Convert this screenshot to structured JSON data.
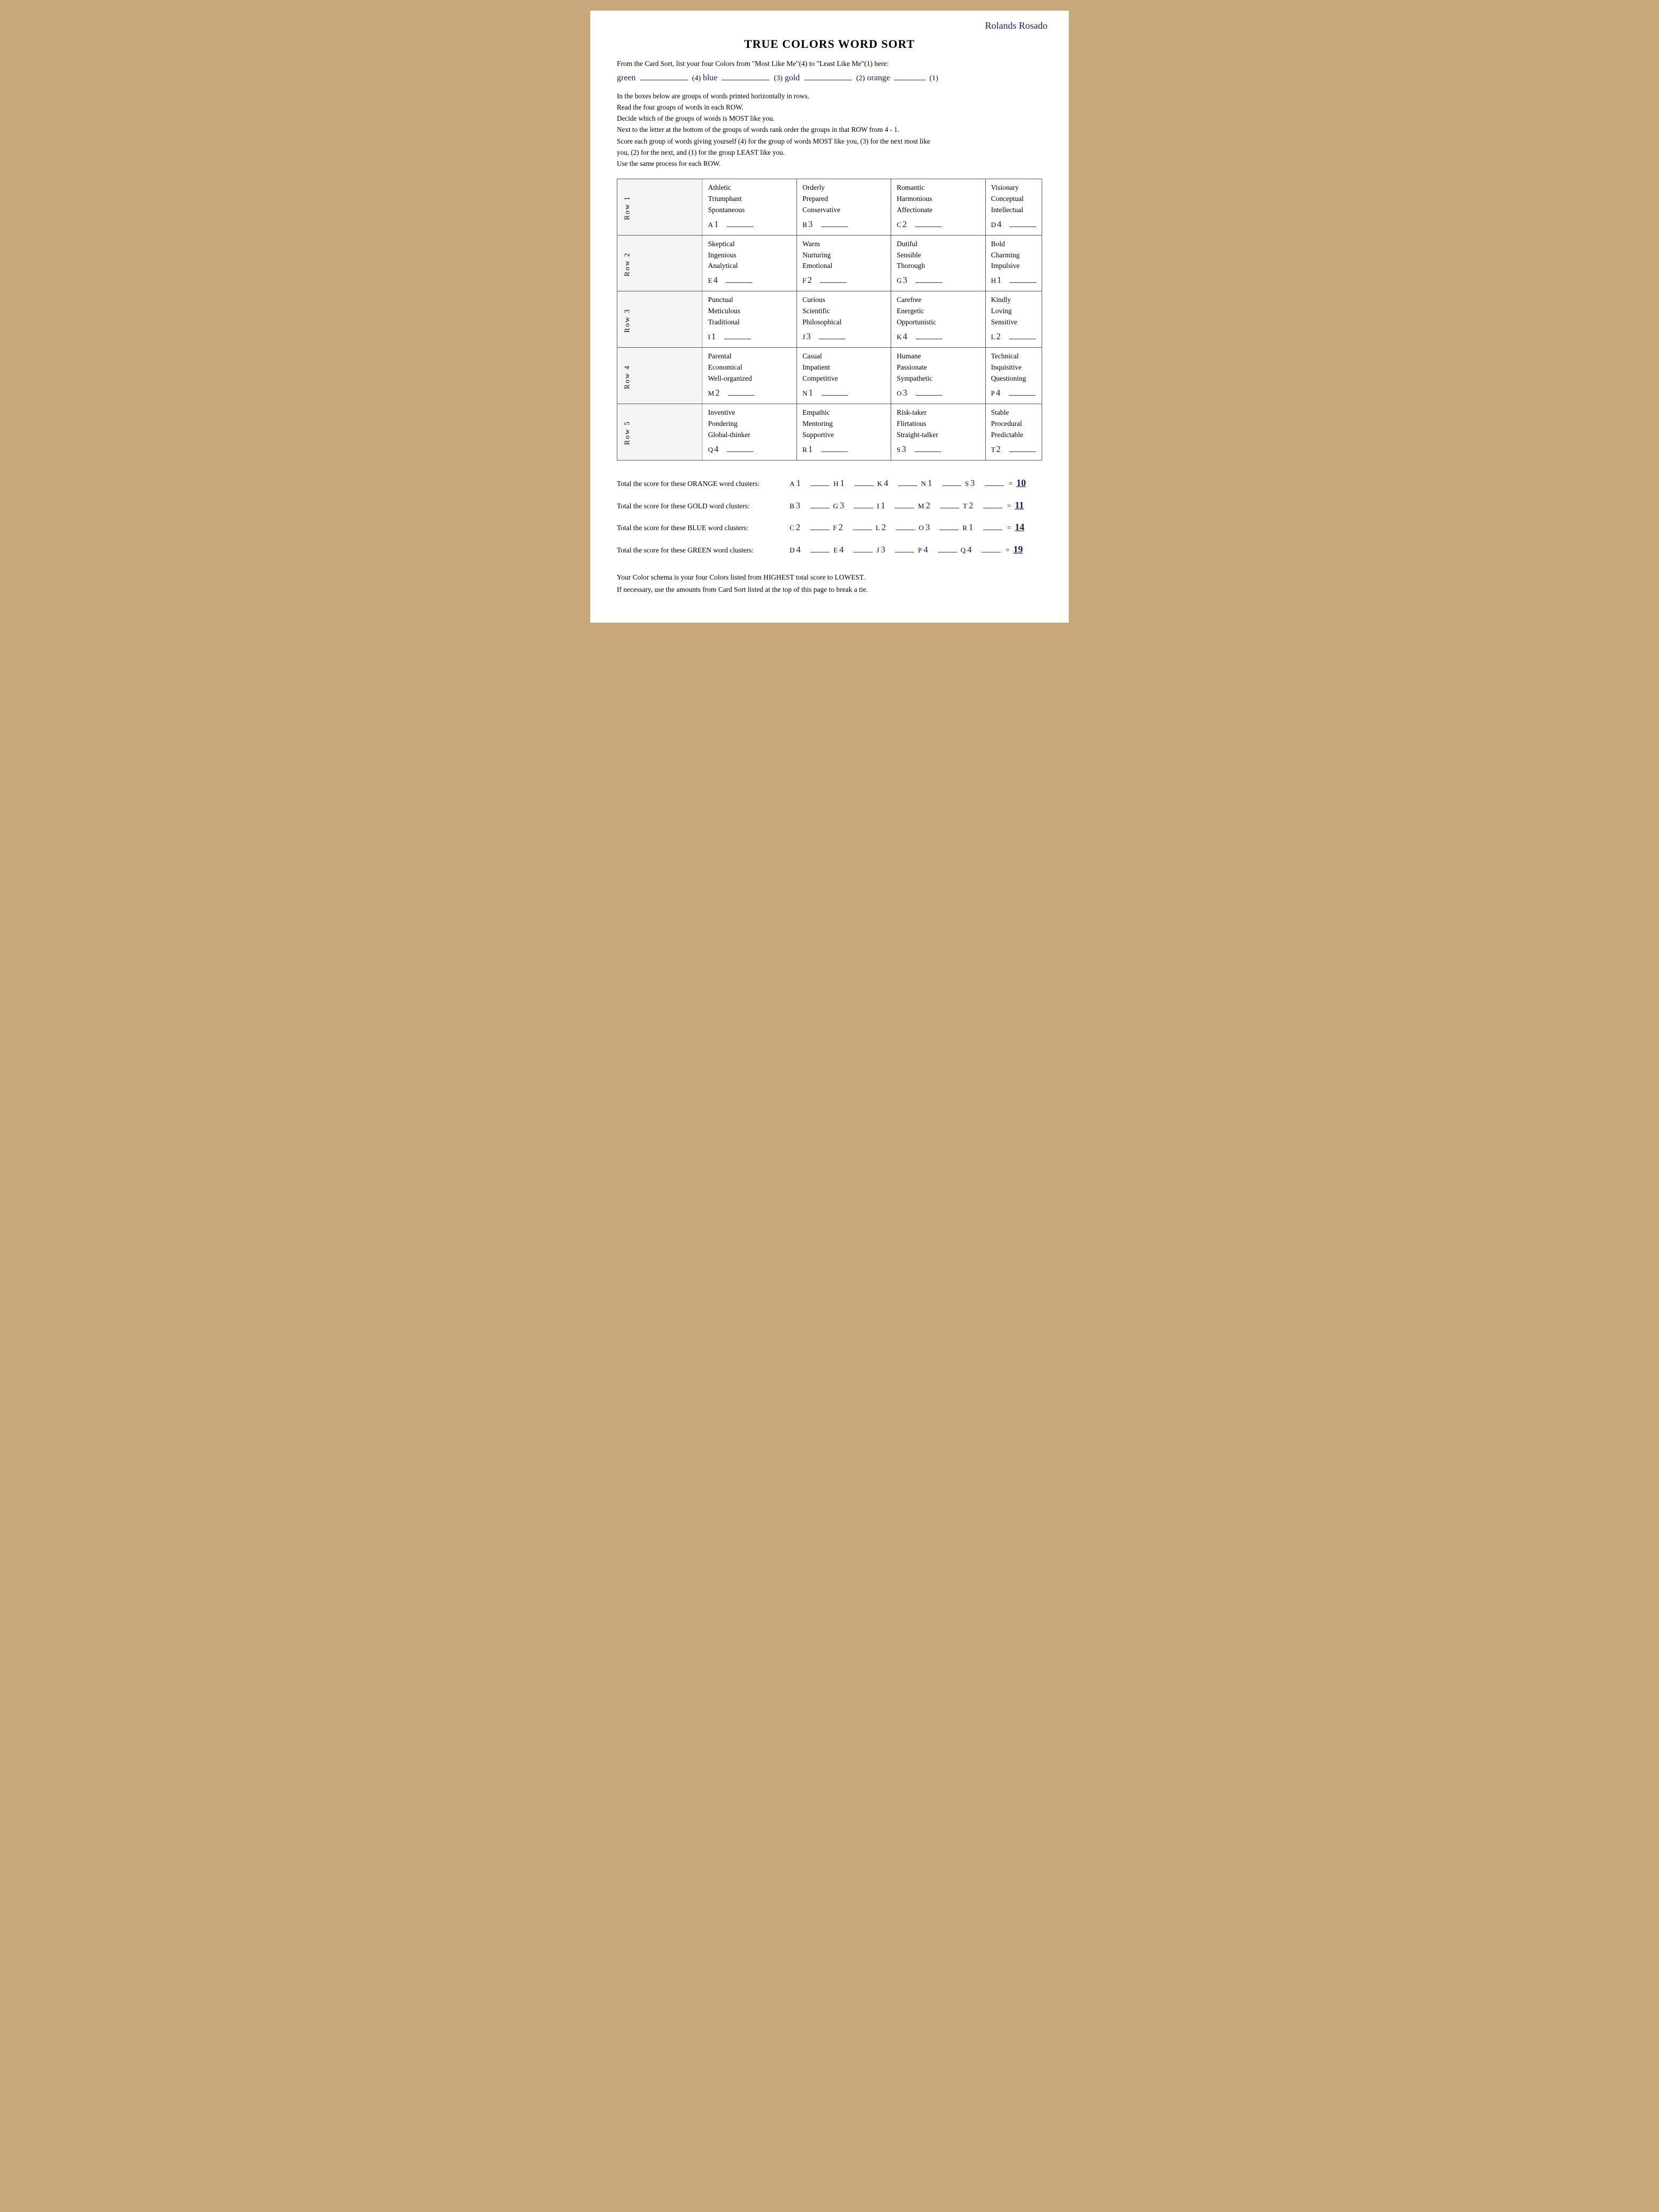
{
  "page": {
    "name": "Rolands Rosado",
    "title": "TRUE COLORS WORD SORT",
    "instruction_top": "From the Card Sort, list your four Colors from \"Most Like Me\"(4) to \"Least Like Me\"(1) here:",
    "color_order": {
      "color1": "green",
      "rank1": "(4)",
      "color2": "blue",
      "rank2": "(3)",
      "color3": "gold",
      "rank3": "(2)",
      "color4": "orange",
      "rank4": "(1)"
    },
    "instructions": [
      "In the boxes below are groups of words printed horizontally in rows.",
      "Read the four groups of words in each ROW.",
      "Decide which of the groups of words is MOST like you.",
      "Next to the letter at the bottom of the groups of words rank order the groups in that ROW from 4 - 1.",
      "Score each group of words giving yourself (4) for the group of words MOST like you, (3) for the next most like",
      "you, (2) for the next, and (1) for the group LEAST like you.",
      "Use the same process for each ROW."
    ],
    "rows": [
      {
        "label": "Row 1",
        "cells": [
          {
            "words": [
              "Athletic",
              "Triumphant",
              "Spontaneous"
            ],
            "letter": "A",
            "score": "1"
          },
          {
            "words": [
              "Orderly",
              "Prepared",
              "Conservative"
            ],
            "letter": "B",
            "score": "3"
          },
          {
            "words": [
              "Romantic",
              "Harmonious",
              "Affectionate"
            ],
            "letter": "C",
            "score": "2"
          },
          {
            "words": [
              "Visionary",
              "Conceptual",
              "Intellectual"
            ],
            "letter": "D",
            "score": "4"
          }
        ]
      },
      {
        "label": "Row 2",
        "cells": [
          {
            "words": [
              "Skeptical",
              "Ingenious",
              "Analytical"
            ],
            "letter": "E",
            "score": "4"
          },
          {
            "words": [
              "Warm",
              "Nurturing",
              "Emotional"
            ],
            "letter": "F",
            "score": "2"
          },
          {
            "words": [
              "Dutiful",
              "Sensible",
              "Thorough"
            ],
            "letter": "G",
            "score": "3"
          },
          {
            "words": [
              "Bold",
              "Charming",
              "Impulsive"
            ],
            "letter": "H",
            "score": "1"
          }
        ]
      },
      {
        "label": "Row 3",
        "cells": [
          {
            "words": [
              "Punctual",
              "Meticulous",
              "Traditional"
            ],
            "letter": "I",
            "score": "1"
          },
          {
            "words": [
              "Curious",
              "Scientific",
              "Philosophical"
            ],
            "letter": "J",
            "score": "3"
          },
          {
            "words": [
              "Carefree",
              "Energetic",
              "Opportunistic"
            ],
            "letter": "K",
            "score": "4"
          },
          {
            "words": [
              "Kindly",
              "Loving",
              "Sensitive"
            ],
            "letter": "L",
            "score": "2"
          }
        ]
      },
      {
        "label": "Row 4",
        "cells": [
          {
            "words": [
              "Parental",
              "Economical",
              "Well-organized"
            ],
            "letter": "M",
            "score": "2"
          },
          {
            "words": [
              "Casual",
              "Impatient",
              "Competitive"
            ],
            "letter": "N",
            "score": "1"
          },
          {
            "words": [
              "Humane",
              "Passionate",
              "Sympathetic"
            ],
            "letter": "O",
            "score": "3"
          },
          {
            "words": [
              "Technical",
              "Inquisitive",
              "Questioning"
            ],
            "letter": "P",
            "score": "4"
          }
        ]
      },
      {
        "label": "Row 5",
        "cells": [
          {
            "words": [
              "Inventive",
              "Pondering",
              "Global-thinker"
            ],
            "letter": "Q",
            "score": "4"
          },
          {
            "words": [
              "Empathic",
              "Mentoring",
              "Supportive"
            ],
            "letter": "R",
            "score": "1"
          },
          {
            "words": [
              "Risk-taker",
              "Flirtatious",
              "Straight-talker"
            ],
            "letter": "S",
            "score": "3"
          },
          {
            "words": [
              "Stable",
              "Procedural",
              "Predictable"
            ],
            "letter": "T",
            "score": "2"
          }
        ]
      }
    ],
    "totals": [
      {
        "label": "Total the score for these ORANGE word clusters:",
        "entries": [
          {
            "letter": "A",
            "score": "1"
          },
          {
            "letter": "H",
            "score": "1"
          },
          {
            "letter": "K",
            "score": "4"
          },
          {
            "letter": "N",
            "score": "1"
          },
          {
            "letter": "S",
            "score": "3"
          }
        ],
        "sum": "10"
      },
      {
        "label": "Total the score for these GOLD word clusters:",
        "entries": [
          {
            "letter": "B",
            "score": "3"
          },
          {
            "letter": "G",
            "score": "3"
          },
          {
            "letter": "I",
            "score": "1"
          },
          {
            "letter": "M",
            "score": "2"
          },
          {
            "letter": "T",
            "score": "2"
          }
        ],
        "sum": "11"
      },
      {
        "label": "Total the score for these BLUE word clusters:",
        "entries": [
          {
            "letter": "C",
            "score": "2"
          },
          {
            "letter": "F",
            "score": "2"
          },
          {
            "letter": "L",
            "score": "2"
          },
          {
            "letter": "O",
            "score": "3"
          },
          {
            "letter": "R",
            "score": "1"
          }
        ],
        "sum": "14"
      },
      {
        "label": "Total the score for these GREEN word clusters:",
        "entries": [
          {
            "letter": "D",
            "score": "4"
          },
          {
            "letter": "E",
            "score": "4"
          },
          {
            "letter": "J",
            "score": "3"
          },
          {
            "letter": "P",
            "score": "4"
          },
          {
            "letter": "Q",
            "score": "4"
          }
        ],
        "sum": "19"
      }
    ],
    "footer": [
      "Your Color schema is your four Colors listed from HIGHEST total score to LOWEST.",
      "If necessary, use the amounts from Card Sort listed at the top of this page to break a tie."
    ]
  }
}
